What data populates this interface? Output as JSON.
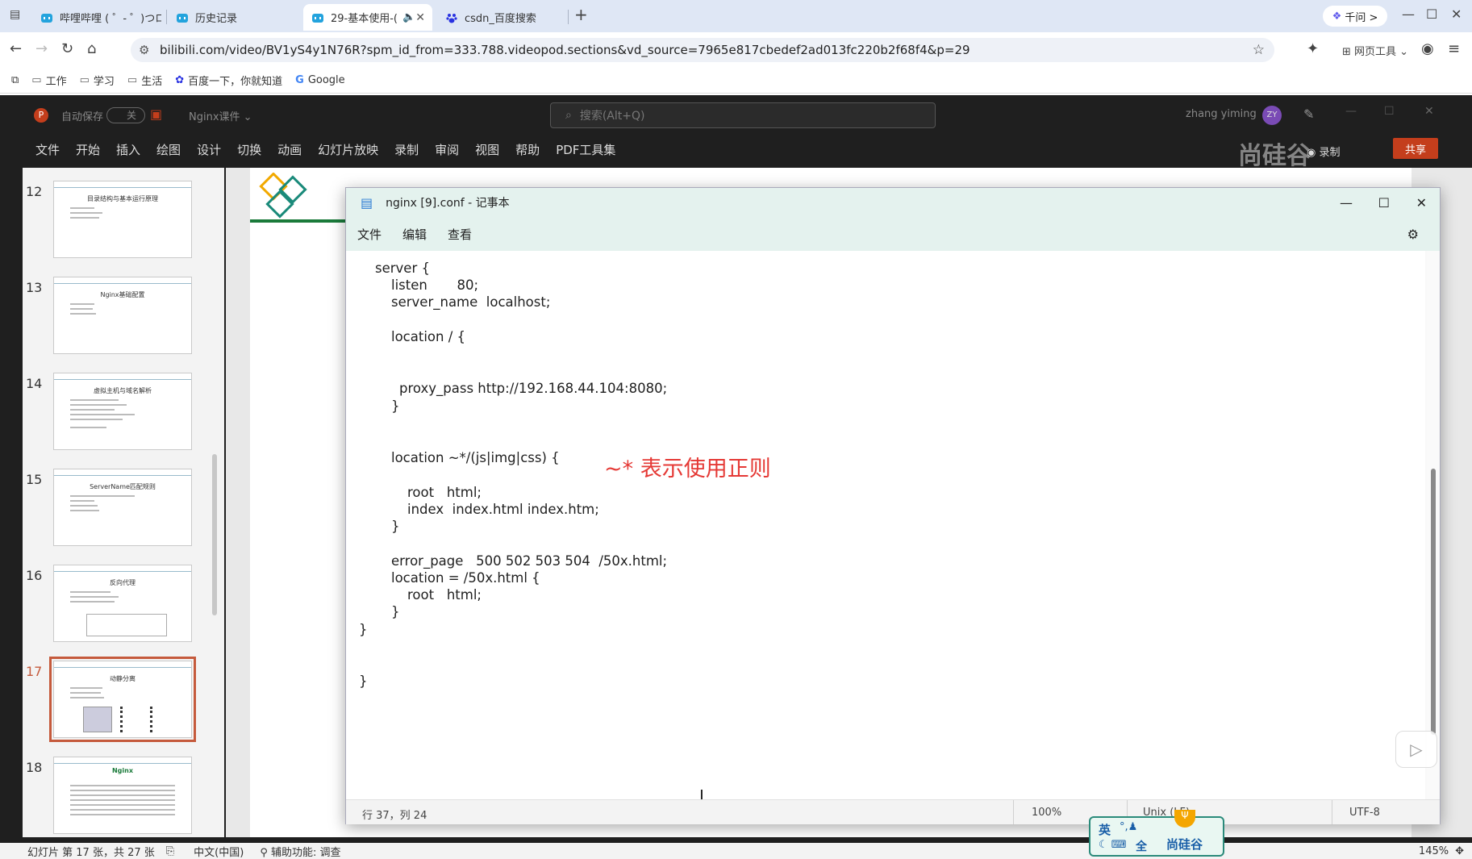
{
  "browser": {
    "tabs": [
      {
        "label": "哔哩哔哩 ( ゜- ゜)つロ",
        "active": false
      },
      {
        "label": "历史记录",
        "active": false
      },
      {
        "label": "29-基本使用-(",
        "active": true
      },
      {
        "label": "csdn_百度搜索",
        "active": false
      }
    ],
    "new_tab": "+",
    "qianwen_label": "千问 >",
    "url": "bilibili.com/video/BV1yS4y1N76R?spm_id_from=333.788.videopod.sections&vd_source=7965e817cbedef2ad013fc220b2f68f4&p=29",
    "tools_label": "网页工具",
    "bookmarks": [
      "工作",
      "学习",
      "生活",
      "百度一下，你就知道",
      "Google"
    ]
  },
  "ppt": {
    "autosave_label": "自动保存",
    "autosave_state": "关",
    "file_name": "Nginx课件",
    "search_placeholder": "搜索(Alt+Q)",
    "user_name": "zhang yiming",
    "user_initials": "ZY",
    "menu": [
      "文件",
      "开始",
      "插入",
      "绘图",
      "设计",
      "切换",
      "动画",
      "幻灯片放映",
      "录制",
      "审阅",
      "视图",
      "帮助",
      "PDF工具集"
    ],
    "record_label": "录制",
    "share_label": "共享",
    "watermark": "尚硅谷",
    "slides": [
      {
        "num": "12",
        "title": "目录结构与基本运行原理"
      },
      {
        "num": "13",
        "title": "Nginx基础配置"
      },
      {
        "num": "14",
        "title": "虚拟主机与域名解析"
      },
      {
        "num": "15",
        "title": "ServerName匹配规则"
      },
      {
        "num": "16",
        "title": "反向代理"
      },
      {
        "num": "17",
        "title": "动静分离"
      },
      {
        "num": "18",
        "title": "Nginx"
      }
    ],
    "status": {
      "slide_info": "幻灯片 第 17 张，共 27 张",
      "language": "中文(中国)",
      "accessibility": "辅助功能: 调查",
      "zoom": "145%"
    }
  },
  "notepad": {
    "title": "nginx [9].conf - 记事本",
    "menu": [
      "文件",
      "编辑",
      "查看"
    ],
    "lines": [
      "server {",
      "listen       80;",
      "server_name  localhost;",
      "location / {",
      "proxy_pass http://192.168.44.104:8080;",
      "}",
      "location ~*/(js|img|css) {",
      "root   html;",
      "index  index.html index.htm;",
      "}",
      "error_page   500 502 503 504  /50x.html;",
      "location = /50x.html {",
      "root   html;",
      "}",
      "}",
      "}"
    ],
    "annotation": "~* 表示使用正则",
    "status": {
      "position": "行 37，列 24",
      "zoom": "100%",
      "line_ending": "Unix (LF)",
      "encoding": "UTF-8"
    }
  },
  "ime": {
    "mode": "英",
    "full": "全",
    "brand": "尚硅谷"
  }
}
